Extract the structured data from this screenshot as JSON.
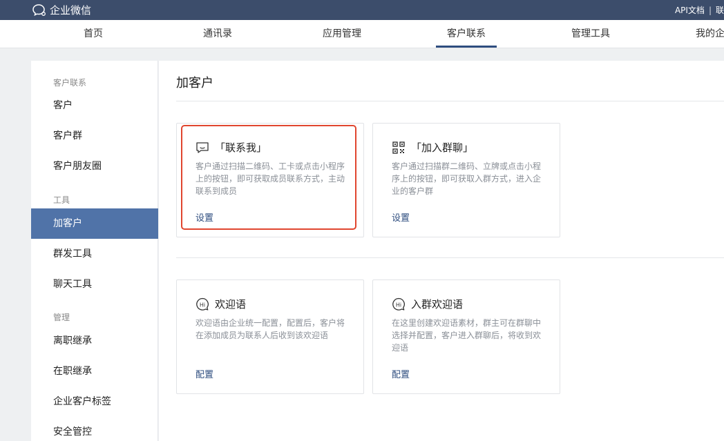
{
  "app": {
    "title": "企业微信",
    "top_links": [
      "API文档",
      "联"
    ]
  },
  "nav": {
    "tabs": [
      {
        "label": "首页"
      },
      {
        "label": "通讯录"
      },
      {
        "label": "应用管理"
      },
      {
        "label": "客户联系",
        "active": true
      },
      {
        "label": "管理工具"
      },
      {
        "label": "我的企"
      }
    ]
  },
  "sidebar": {
    "groups": [
      {
        "title": "客户联系",
        "items": [
          "客户",
          "客户群",
          "客户朋友圈"
        ]
      },
      {
        "title": "工具",
        "items": [
          "加客户",
          "群发工具",
          "聊天工具"
        ]
      },
      {
        "title": "管理",
        "items": [
          "离职继承",
          "在职继承",
          "企业客户标签",
          "安全管控"
        ]
      }
    ],
    "active_item": "加客户"
  },
  "main": {
    "title": "加客户",
    "cards": [
      {
        "icon": "chat-bubble-icon",
        "title": "「联系我」",
        "desc": "客户通过扫描二维码、工卡或点击小程序上的按钮，即可获取成员联系方式，主动联系到成员",
        "action": "设置",
        "highlighted": true
      },
      {
        "icon": "qr-code-icon",
        "title": "「加入群聊」",
        "desc": "客户通过扫描群二维码、立牌或点击小程序上的按钮，即可获取入群方式，进入企业的客户群",
        "action": "设置"
      },
      {
        "icon": "hi-bubble-icon",
        "title": "欢迎语",
        "desc": "欢迎语由企业统一配置，配置后，客户将在添加成员为联系人后收到该欢迎语",
        "action": "配置"
      },
      {
        "icon": "hi-bubble-icon",
        "title": "入群欢迎语",
        "desc": "在这里创建欢迎语素材，群主可在群聊中选择并配置，客户进入群聊后，将收到欢迎语",
        "action": "配置"
      }
    ]
  },
  "colors": {
    "topbar": "#3c4d6b",
    "accent": "#2e4d7f",
    "sidebar_active": "#5073a8",
    "highlight": "#e0452e"
  }
}
